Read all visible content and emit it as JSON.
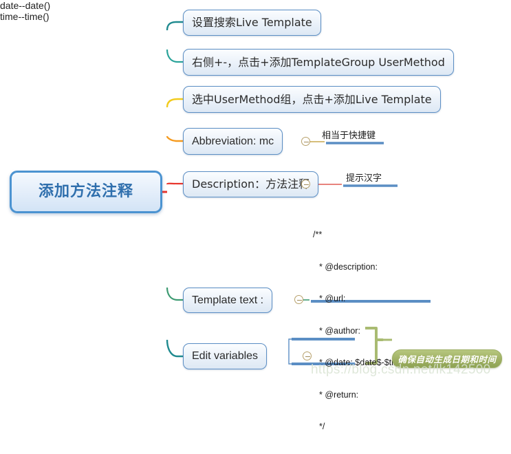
{
  "map": {
    "root": {
      "label": "添加方法注释"
    },
    "branches": [
      {
        "id": "b1",
        "label": "设置搜索Live Template",
        "color": "#1f8a8f"
      },
      {
        "id": "b2",
        "label": "右侧+-，点击+添加TemplateGroup UserMethod",
        "color": "#2aa39a"
      },
      {
        "id": "b3",
        "label": "选中UserMethod组，点击+添加Live Template",
        "color": "#f2cb1d"
      },
      {
        "id": "b4",
        "label": "Abbreviation: mc",
        "color": "#f59a1e"
      },
      {
        "id": "b5",
        "label": "Description：方法注释",
        "color": "#e8352c"
      },
      {
        "id": "b6",
        "label": "Template text :",
        "color": "#3d9b72"
      },
      {
        "id": "b7",
        "label": "Edit variables",
        "color": "#1f8a8f"
      }
    ],
    "annotations": {
      "abbreviation_note": "相当于快捷键",
      "description_note": "提示汉字"
    },
    "template_text": {
      "lines": [
        "/**",
        "* @description:",
        "* @url:",
        "* @author:",
        "* @date: $date$-$time$",
        "* @return:",
        "*/"
      ]
    },
    "variables": [
      {
        "label": "date--date()"
      },
      {
        "label": "time--time()"
      }
    ],
    "callout": {
      "label": "确保自动生成日期和时间"
    },
    "watermark": {
      "text": "https://blog.csdn.net/lk142500"
    }
  },
  "colors": {
    "node_border": "#5b8ec4",
    "root_border": "#4b93d1",
    "root_text": "#2f6fad",
    "underline": "#5b8ec4",
    "callout_bg": "#9fb063",
    "trunk": "#1f7f86"
  }
}
